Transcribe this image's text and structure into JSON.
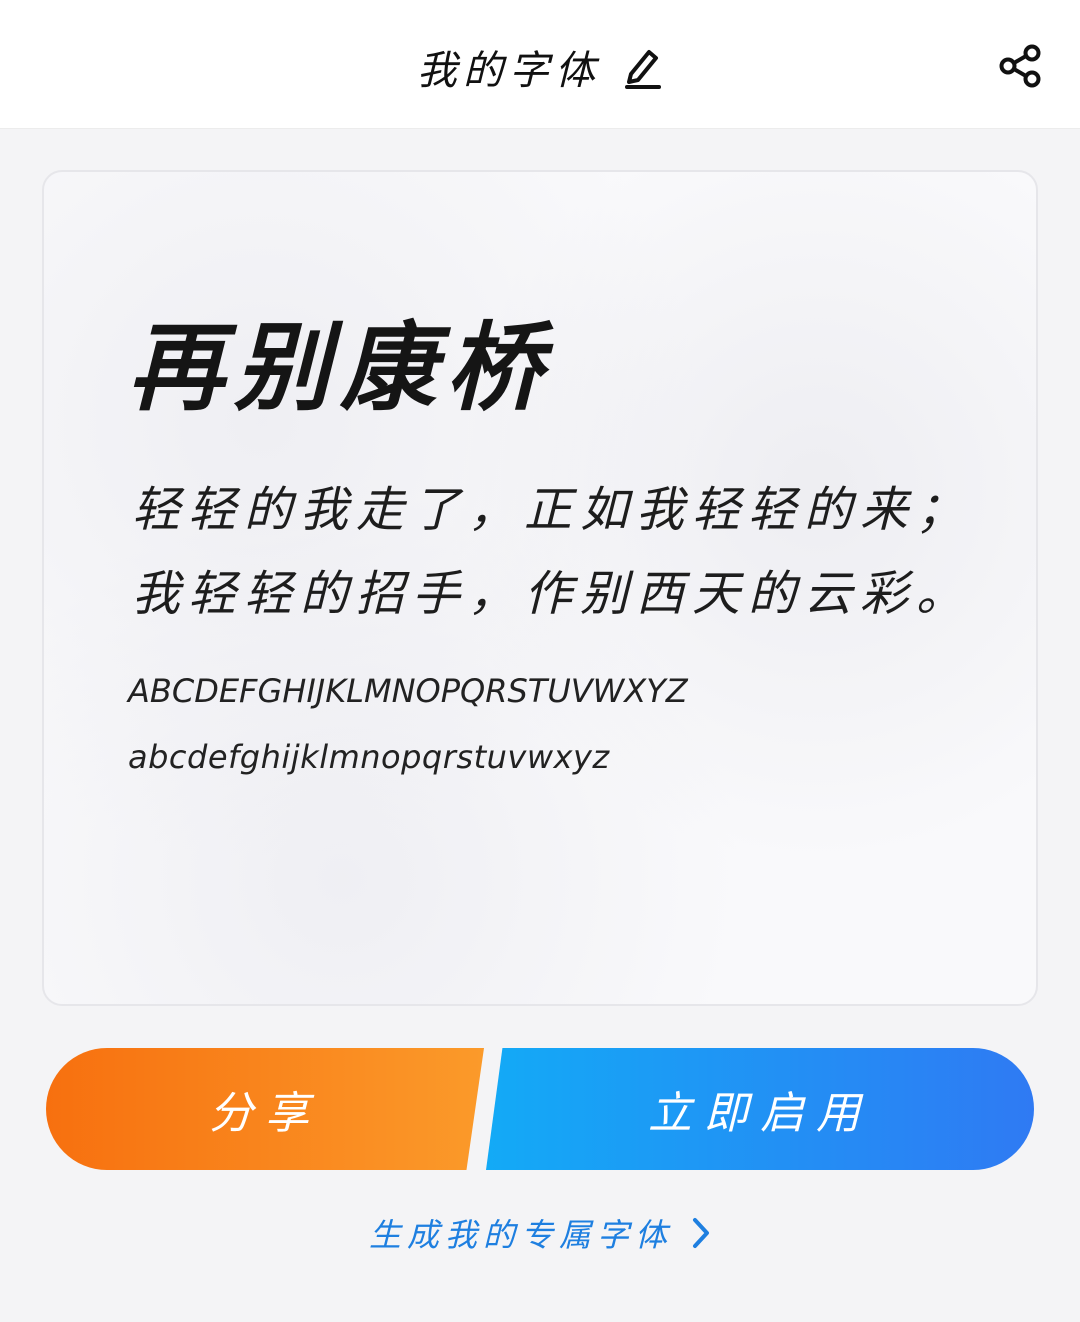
{
  "header": {
    "title": "我的字体"
  },
  "preview": {
    "title": "再别康桥",
    "poem_lines": [
      "轻轻的我走了，正如我轻轻的来；",
      "我轻轻的招手，作别西天的云彩。"
    ],
    "uppercase": "ABCDEFGHIJKLMNOPQRSTUVWXYZ",
    "lowercase": "abcdefghijklmnopqrstuvwxyz"
  },
  "actions": {
    "share_label": "分享",
    "enable_label": "立即启用",
    "generate_label": "生成我的专属字体"
  },
  "colors": {
    "share_start": "#f7700f",
    "share_end": "#fb9a2a",
    "enable_start": "#13aaf6",
    "enable_end": "#2f7af3",
    "link": "#1e7fe0"
  },
  "icons": {
    "edit": "edit-icon",
    "share": "share-icon",
    "chevron": "chevron-right-icon"
  }
}
